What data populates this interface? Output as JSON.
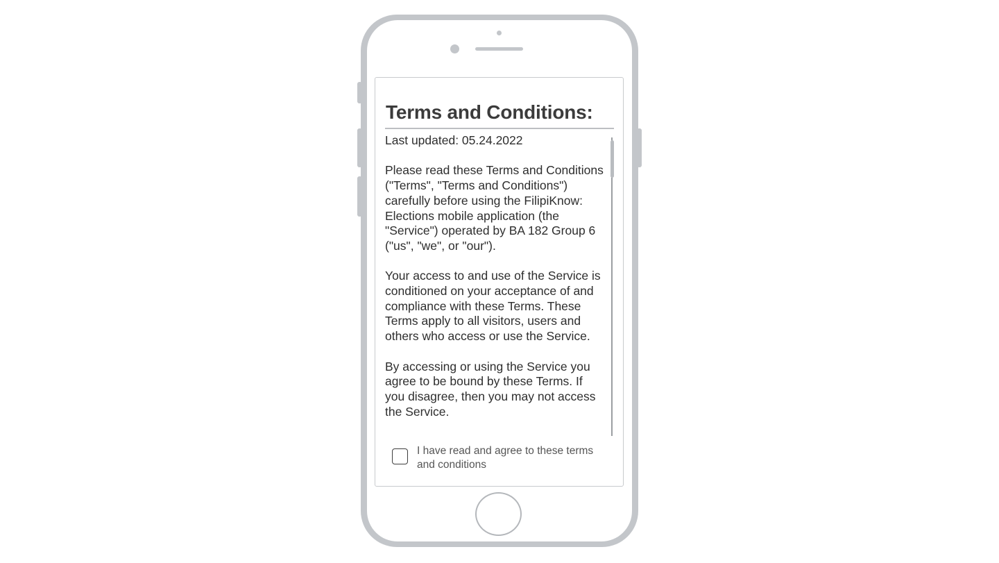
{
  "screen": {
    "title": "Terms and Conditions:",
    "last_updated": "Last updated: 05.24.2022",
    "paragraphs": [
      "Please read these Terms and Conditions (\"Terms\", \"Terms and Conditions\") carefully before using the FilipiKnow: Elections mobile application (the \"Service\") operated by BA 182 Group 6 (\"us\", \"we\", or \"our\").",
      "Your access to and use of the Service is conditioned on your acceptance of and compliance with these Terms. These Terms apply to all visitors, users and others who access or use the Service.",
      "By accessing or using the Service you agree to be bound by these Terms. If you disagree, then you may not access the Service."
    ],
    "agree_checkbox": {
      "label": "I have read and agree to these terms and conditions",
      "checked": false
    }
  },
  "colors": {
    "phone_frame": "#c3c6ca",
    "title_text": "#3b3b3b",
    "body_text": "#2e2e2e",
    "label_text": "#555555"
  }
}
